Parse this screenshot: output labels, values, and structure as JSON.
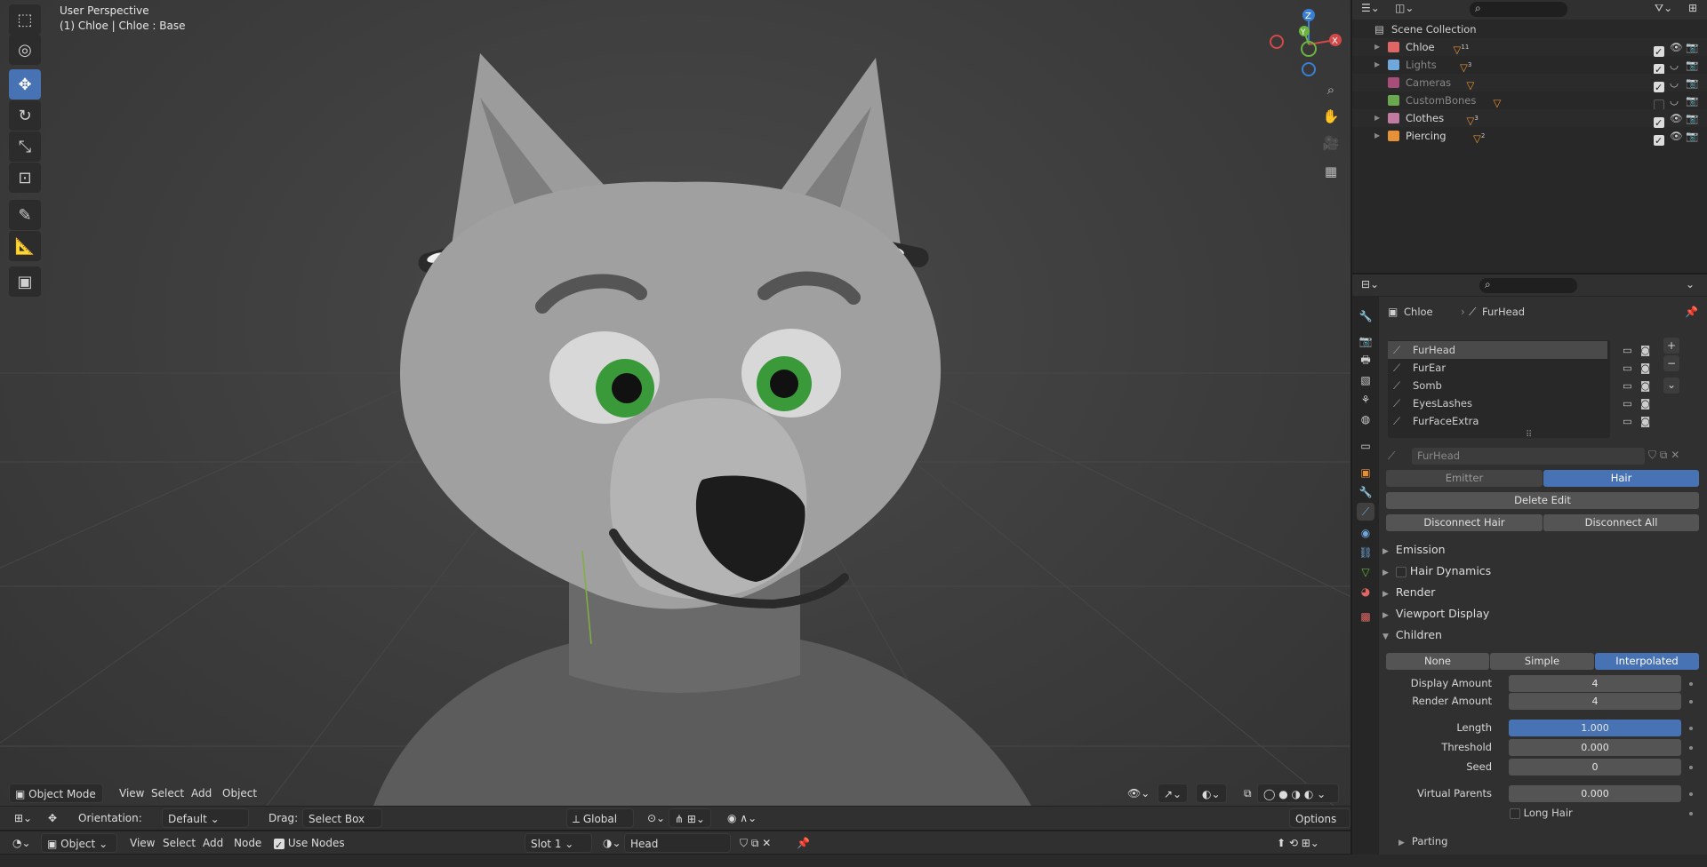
{
  "viewport": {
    "title": "User Perspective",
    "subtitle": "(1) Chloe | Chloe : Base",
    "gizmo": {
      "z": "Z",
      "y": "Y",
      "x": "X"
    },
    "tools": [
      "select-box-icon",
      "cursor-icon",
      "move-icon",
      "rotate-icon",
      "scale-icon",
      "transform-icon",
      "annotate-icon",
      "measure-icon",
      "add-cube-icon"
    ],
    "header": {
      "mode": "Object Mode",
      "menus": [
        "View",
        "Select",
        "Add",
        "Object"
      ]
    }
  },
  "tool_header": {
    "orientation_label": "Orientation:",
    "orientation_value": "Default",
    "drag_label": "Drag:",
    "drag_value": "Select Box",
    "transform_orientation": "Global",
    "options": "Options"
  },
  "shader_header": {
    "editor": "Object",
    "menus": [
      "View",
      "Select",
      "Add",
      "Node"
    ],
    "use_nodes": "Use Nodes",
    "slot": "Slot 1",
    "material": "Head"
  },
  "outliner": {
    "root": "Scene Collection",
    "items": [
      {
        "name": "Chloe",
        "color": "#e06666",
        "badge": "11",
        "enabled": true,
        "dim": false
      },
      {
        "name": "Lights",
        "color": "#6fa8dc",
        "badge": "3",
        "enabled": true,
        "dim": true
      },
      {
        "name": "Cameras",
        "color": "#a64d79",
        "badge": "",
        "enabled": true,
        "dim": true
      },
      {
        "name": "CustomBones",
        "color": "#6aa84f",
        "badge": "",
        "enabled": false,
        "dim": true
      },
      {
        "name": "Clothes",
        "color": "#c27ba0",
        "badge": "3",
        "enabled": true,
        "dim": false
      },
      {
        "name": "Piercing",
        "color": "#e69138",
        "badge": "2",
        "enabled": true,
        "dim": false
      }
    ]
  },
  "properties": {
    "breadcrumb_object": "Chloe",
    "breadcrumb_system": "FurHead",
    "systems": [
      "FurHead",
      "FurEar",
      "Somb",
      "EyesLashes",
      "FurFaceExtra"
    ],
    "settings_name": "FurHead",
    "type_options": [
      "Emitter",
      "Hair"
    ],
    "type_selected": "Hair",
    "delete_edit": "Delete Edit",
    "disconnect_hair": "Disconnect Hair",
    "disconnect_all": "Disconnect All",
    "sections": {
      "emission": "Emission",
      "hair_dynamics": "Hair Dynamics",
      "render": "Render",
      "viewport_display": "Viewport Display",
      "children": "Children"
    },
    "children_modes": [
      "None",
      "Simple",
      "Interpolated"
    ],
    "children_selected": "Interpolated",
    "display_amount_label": "Display Amount",
    "display_amount": "4",
    "render_amount_label": "Render Amount",
    "render_amount": "4",
    "length_label": "Length",
    "length": "1.000",
    "threshold_label": "Threshold",
    "threshold": "0.000",
    "seed_label": "Seed",
    "seed": "0",
    "virtual_parents_label": "Virtual Parents",
    "virtual_parents": "0.000",
    "long_hair": "Long Hair",
    "parting": "Parting"
  },
  "colors": {
    "accent": "#4772b3",
    "fur": "#9a9a9a",
    "eye_iris": "#3a9a3a"
  }
}
